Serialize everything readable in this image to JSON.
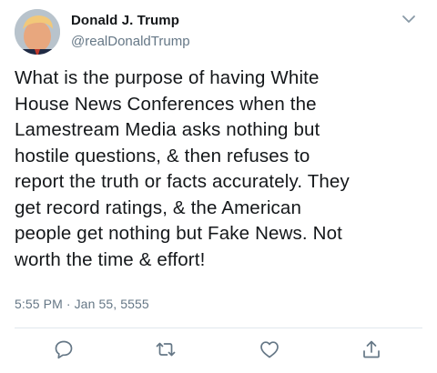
{
  "user": {
    "display_name": "Donald J. Trump",
    "handle": "@realDonaldTrump"
  },
  "tweet": {
    "text": "What is the purpose of having White\nHouse News Conferences when the\nLamestream Media asks nothing but\nhostile questions, & then refuses to\nreport the truth or facts accurately. They\nget record ratings, & the American\npeople get nothing but Fake News. Not\nworth the time & effort!",
    "timestamp": "5:55 PM · Jan 55, 5555"
  },
  "icons": {
    "menu": "chevron-down-icon",
    "reply": "reply-icon",
    "retweet": "retweet-icon",
    "like": "heart-icon",
    "share": "share-icon"
  },
  "colors": {
    "text": "#14171a",
    "secondary": "#657786",
    "icon": "#657786",
    "divider": "#e1e8ed",
    "background": "#ffffff"
  }
}
